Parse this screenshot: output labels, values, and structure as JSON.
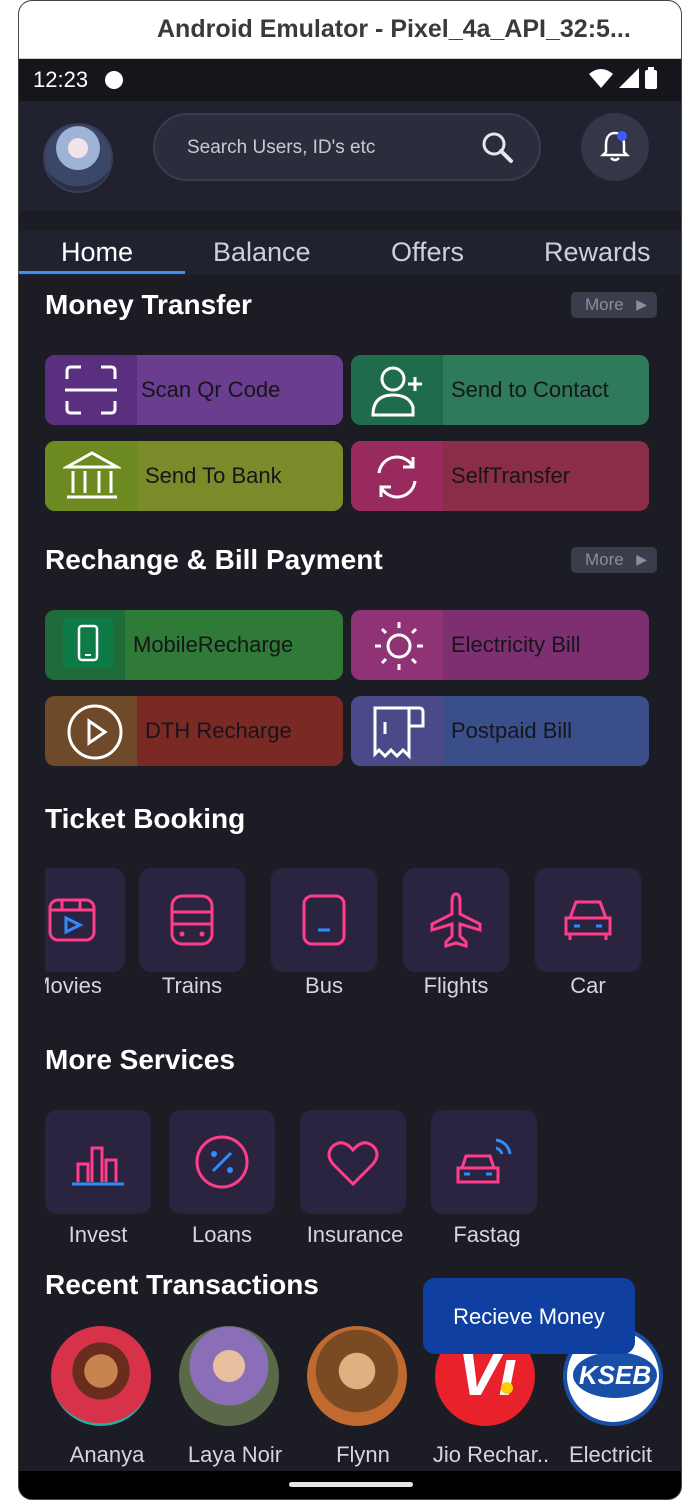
{
  "window": {
    "title": "Android Emulator - Pixel_4a_API_32:5..."
  },
  "status": {
    "time": "12:23"
  },
  "search": {
    "placeholder": "Search Users, ID's etc"
  },
  "tabs": [
    "Home",
    "Balance",
    "Offers",
    "Rewards"
  ],
  "sections": {
    "money_transfer": "Money Transfer",
    "recharge": "Rechange & Bill Payment",
    "tickets": "Ticket Booking",
    "more_services": "More Services",
    "recent": "Recent Transactions"
  },
  "more_label": "More",
  "money_transfer_items": [
    {
      "label": "Scan Qr Code",
      "icon": "scan-qr-icon",
      "color": "#6a3d8f"
    },
    {
      "label": "Send to Contact",
      "icon": "contact-add-icon",
      "color": "#2e7a5a"
    },
    {
      "label": "Send To Bank",
      "icon": "bank-icon",
      "color": "#7d8a2a"
    },
    {
      "label": "SelfTransfer",
      "icon": "refresh-icon",
      "color": "#8a2e48"
    }
  ],
  "recharge_items": [
    {
      "label": "MobileRecharge",
      "icon": "mobile-icon",
      "color": "#2e7a36"
    },
    {
      "label": "Electricity Bill",
      "icon": "sun-icon",
      "color": "#7e2f72"
    },
    {
      "label": "DTH Recharge",
      "icon": "play-icon",
      "color": "#7a2a24"
    },
    {
      "label": "Postpaid Bill",
      "icon": "receipt-icon",
      "color": "#3a4f8a"
    }
  ],
  "ticket_items": [
    "Movies",
    "Trains",
    "Bus",
    "Flights",
    "Car"
  ],
  "service_items": [
    "Invest",
    "Loans",
    "Insurance",
    "Fastag"
  ],
  "recent_items": [
    "Ananya",
    "Laya Noir",
    "Flynn",
    "Jio Rechar..",
    "Electricit"
  ],
  "fab": {
    "label": "Recieve Money"
  },
  "colors": {
    "accent": "#3b8ff7",
    "icon_pink": "#ff3d8b",
    "tile_bg": "#2b2440"
  }
}
